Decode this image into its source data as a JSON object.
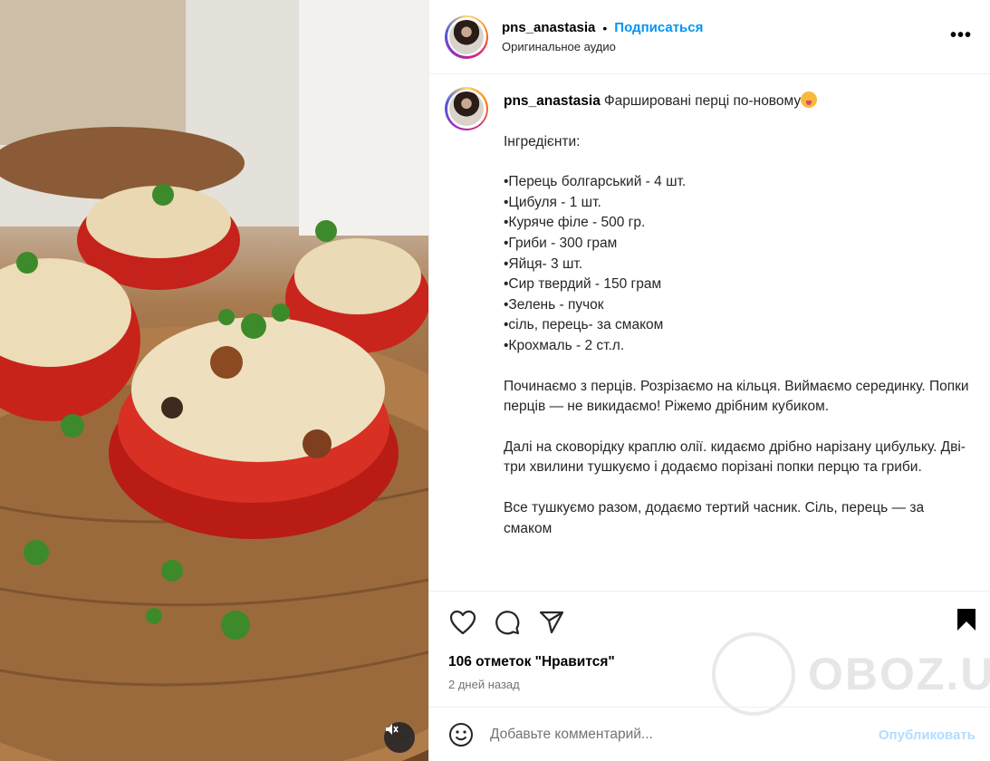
{
  "post": {
    "username": "pns_anastasia",
    "separator": "•",
    "follow_label": "Подписаться",
    "audio_label": "Оригинальное аудио",
    "more_label": "•••"
  },
  "caption": {
    "username": "pns_anastasia",
    "title": "Фаршировані перці по-новому",
    "emoji_icon": "tongue-out-face-icon",
    "paragraphs": [
      "Інгредієнти:",
      "•Перець болгарський - 4 шт.\n•Цибуля - 1 шт.\n•Куряче філе - 500 гр.\n•Гриби - 300 грам\n•Яйця- 3 шт.\n•Сир твердий - 150 грам\n•Зелень - пучок\n•сіль, перець- за смаком\n•Крохмаль - 2 ст.л.",
      "Починаємо з перців. Розрізаємо на кільця. Виймаємо серединку. Попки перців — не викидаємо! Ріжемо дрібним кубиком.",
      "Далі на сковорідку краплю олії. кидаємо дрібно нарізану цибульку. Дві-три хвилини тушкуємо і додаємо порізані попки перцю та гриби.",
      "Все тушкуємо разом, додаємо тертий часник. Сіль, перець — за смаком"
    ]
  },
  "actions": {
    "like_icon": "heart-icon",
    "comment_icon": "comment-bubble-icon",
    "share_icon": "paper-plane-icon",
    "save_icon": "bookmark-icon"
  },
  "likes_text": "106 отметок \"Нравится\"",
  "date_text": "2 дней назад",
  "comment": {
    "placeholder": "Добавьте комментарий...",
    "publish_label": "Опубликовать",
    "emoji_icon": "smiley-icon"
  },
  "watermark": {
    "text": "OBOZ.UA"
  },
  "colors": {
    "accent": "#0095f6",
    "publish_disabled": "#b3dbff",
    "border": "#efefef"
  }
}
